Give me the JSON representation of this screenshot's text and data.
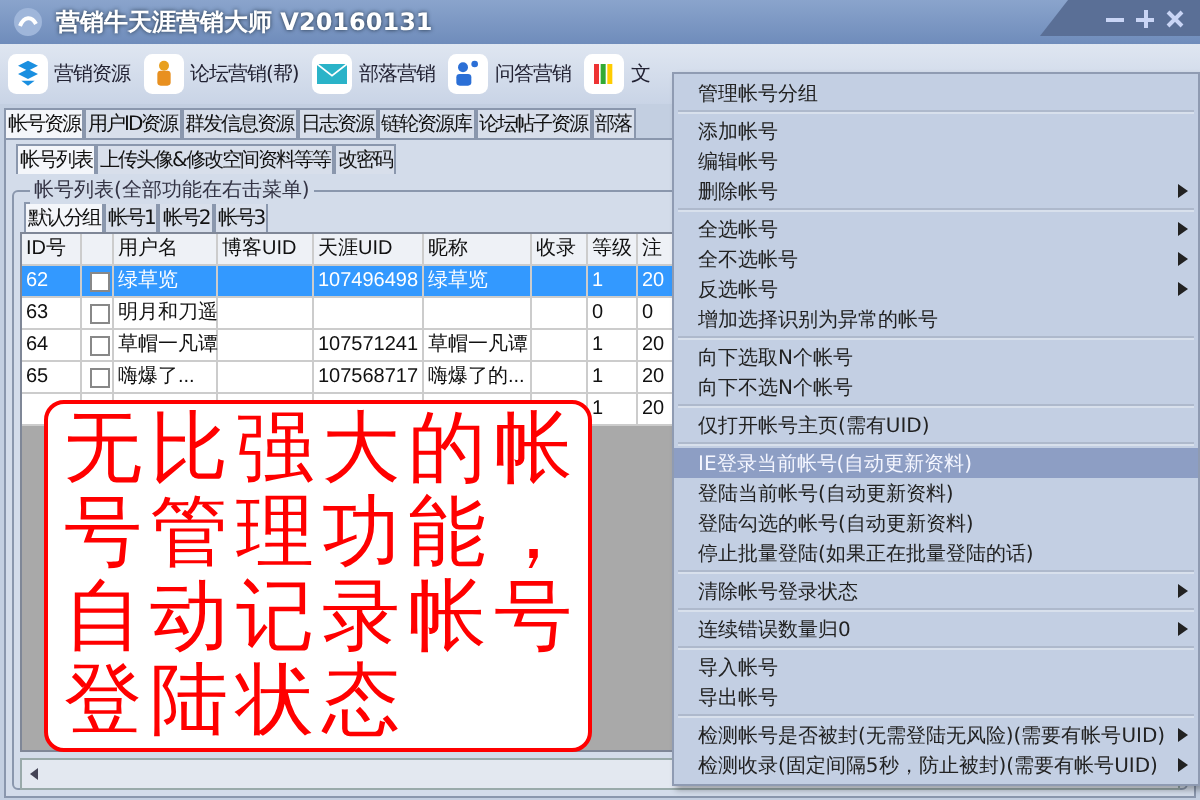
{
  "window": {
    "title": "营销牛天涯营销大师 V20160131"
  },
  "toolbar": [
    {
      "label": "营销资源",
      "kind": "box"
    },
    {
      "label": "论坛营销(帮)",
      "kind": "figure"
    },
    {
      "label": "部落营销",
      "kind": "mail"
    },
    {
      "label": "问答营销",
      "kind": "people"
    },
    {
      "label": "文",
      "kind": "bars"
    }
  ],
  "main_tabs": [
    {
      "label": "帐号资源",
      "selected": true
    },
    {
      "label": "用户ID资源",
      "selected": false
    },
    {
      "label": "群发信息资源",
      "selected": false
    },
    {
      "label": "日志资源",
      "selected": false
    },
    {
      "label": "链轮资源库",
      "selected": false
    },
    {
      "label": "论坛帖子资源",
      "selected": false
    },
    {
      "label": "部落",
      "selected": false
    }
  ],
  "sub_tabs": [
    {
      "label": "帐号列表",
      "selected": true
    },
    {
      "label": "上传头像&修改空间资料等等",
      "selected": false
    },
    {
      "label": "改密码",
      "selected": false
    }
  ],
  "group_box": {
    "title": "帐号列表(全部功能在右击菜单)"
  },
  "group_tabs": [
    {
      "label": "默认分组",
      "selected": true
    },
    {
      "label": "帐号1",
      "selected": false
    },
    {
      "label": "帐号2",
      "selected": false
    },
    {
      "label": "帐号3",
      "selected": false
    }
  ],
  "table": {
    "columns": [
      "ID号",
      "",
      "用户名",
      "博客UID",
      "天涯UID",
      "昵称",
      "收录",
      "等级",
      "注"
    ],
    "rows": [
      {
        "selected": true,
        "checked": false,
        "cells": [
          "62",
          "",
          "绿草览",
          "",
          "107496498",
          "绿草览",
          "",
          "1",
          "20"
        ]
      },
      {
        "selected": false,
        "checked": false,
        "cells": [
          "63",
          "",
          "明月和刀遥",
          "",
          "",
          "",
          "",
          "0",
          "0"
        ]
      },
      {
        "selected": false,
        "checked": false,
        "cells": [
          "64",
          "",
          "草帽一凡谭",
          "",
          "107571241",
          "草帽一凡谭",
          "",
          "1",
          "20"
        ]
      },
      {
        "selected": false,
        "checked": false,
        "cells": [
          "65",
          "",
          "嗨爆了...",
          "",
          "107568717",
          "嗨爆了的...",
          "",
          "1",
          "20"
        ]
      },
      {
        "selected": false,
        "cells": [
          "",
          "",
          "",
          "",
          "",
          "",
          "",
          "1",
          "20"
        ]
      }
    ]
  },
  "callout": {
    "text": "无比强大的帐号管理功能，自动记录帐号登陆状态"
  },
  "context_menu": {
    "groups": [
      {
        "items": [
          {
            "label": "管理帐号分组",
            "submenu": false,
            "highlighted": false
          }
        ]
      },
      {
        "items": [
          {
            "label": "添加帐号",
            "submenu": false,
            "highlighted": false
          },
          {
            "label": "编辑帐号",
            "submenu": false,
            "highlighted": false
          },
          {
            "label": "删除帐号",
            "submenu": true,
            "highlighted": false
          }
        ]
      },
      {
        "items": [
          {
            "label": "全选帐号",
            "submenu": true,
            "highlighted": false
          },
          {
            "label": "全不选帐号",
            "submenu": true,
            "highlighted": false
          },
          {
            "label": "反选帐号",
            "submenu": true,
            "highlighted": false
          },
          {
            "label": "增加选择识别为异常的帐号",
            "submenu": false,
            "highlighted": false
          }
        ]
      },
      {
        "items": [
          {
            "label": "向下选取N个帐号",
            "submenu": false,
            "highlighted": false
          },
          {
            "label": "向下不选N个帐号",
            "submenu": false,
            "highlighted": false
          }
        ]
      },
      {
        "items": [
          {
            "label": "仅打开帐号主页(需有UID)",
            "submenu": false,
            "highlighted": false
          }
        ]
      },
      {
        "items": [
          {
            "label": "IE登录当前帐号(自动更新资料)",
            "submenu": false,
            "highlighted": true
          },
          {
            "label": "登陆当前帐号(自动更新资料)",
            "submenu": false,
            "highlighted": false
          },
          {
            "label": "登陆勾选的帐号(自动更新资料)",
            "submenu": false,
            "highlighted": false
          },
          {
            "label": "停止批量登陆(如果正在批量登陆的话)",
            "submenu": false,
            "highlighted": false
          }
        ]
      },
      {
        "items": [
          {
            "label": "清除帐号登录状态",
            "submenu": true,
            "highlighted": false
          }
        ]
      },
      {
        "items": [
          {
            "label": "连续错误数量归0",
            "submenu": true,
            "highlighted": false
          }
        ]
      },
      {
        "items": [
          {
            "label": "导入帐号",
            "submenu": false,
            "highlighted": false
          },
          {
            "label": "导出帐号",
            "submenu": false,
            "highlighted": false
          }
        ]
      },
      {
        "items": [
          {
            "label": "检测帐号是否被封(无需登陆无风险)(需要有帐号UID)",
            "submenu": true,
            "highlighted": false
          },
          {
            "label": "检测收录(固定间隔5秒，防止被封)(需要有帐号UID)",
            "submenu": true,
            "highlighted": false
          }
        ]
      }
    ]
  }
}
